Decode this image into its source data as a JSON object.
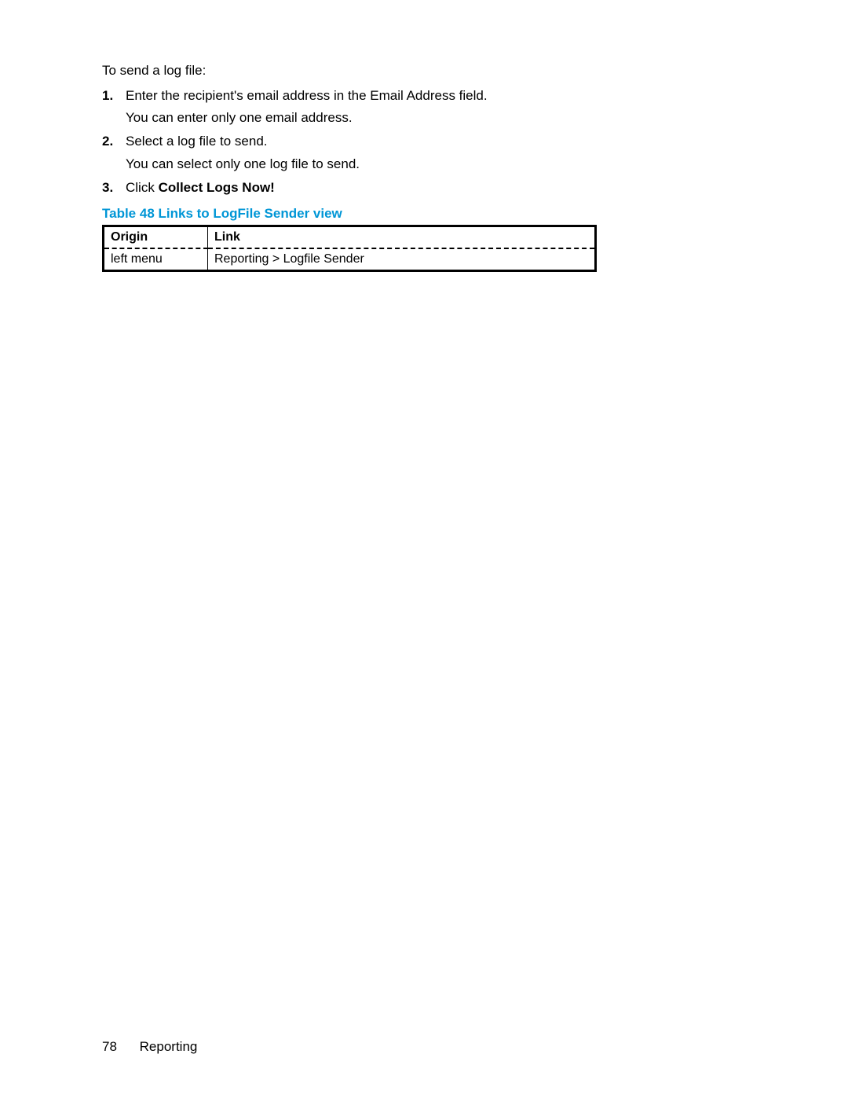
{
  "intro": "To send a log file:",
  "steps": [
    {
      "num": "1.",
      "text": "Enter the recipient's email address in the Email Address field.",
      "sub": "You can enter only one email address."
    },
    {
      "num": "2.",
      "text": "Select a log file to send.",
      "sub": "You can select only one log file to send."
    },
    {
      "num": "3.",
      "text_prefix": "Click ",
      "text_bold": "Collect Logs Now!"
    }
  ],
  "table_caption": "Table 48 Links to LogFile Sender view",
  "table": {
    "headers": {
      "origin": "Origin",
      "link": "Link"
    },
    "rows": [
      {
        "origin": "left menu",
        "link": "Reporting > Logfile Sender"
      }
    ]
  },
  "footer": {
    "page": "78",
    "section": "Reporting"
  }
}
